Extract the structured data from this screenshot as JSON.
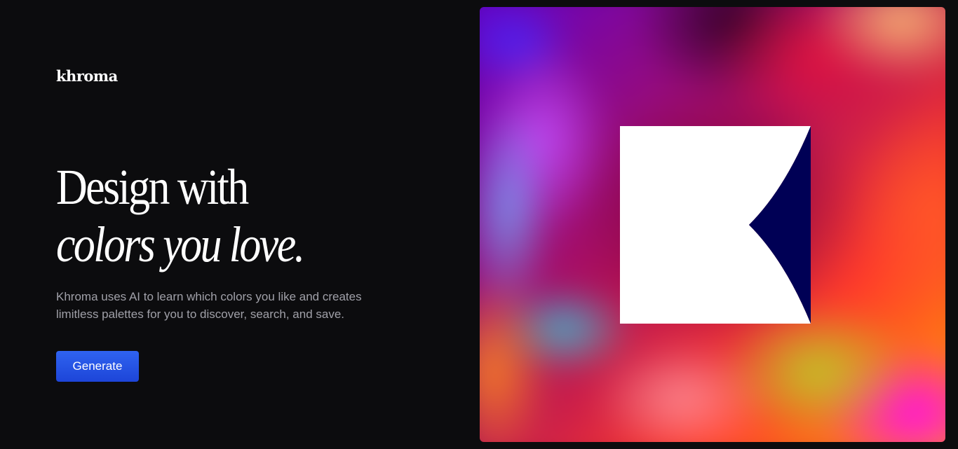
{
  "brand": {
    "logo_text": "khroma"
  },
  "hero": {
    "headline_line1": "Design with",
    "headline_line2": "colors you love.",
    "tagline": "Khroma uses AI to learn which colors you like and creates limitless palettes for you to discover, search, and save.",
    "cta_label": "Generate"
  },
  "colors": {
    "background": "#0c0c0e",
    "cta": "#2656e8",
    "tagline_text": "#a0a0a8",
    "k_mark": "#ffffff",
    "k_notch": "#000055"
  },
  "icons": {
    "hero_mark": "khroma-k-logo-icon"
  }
}
